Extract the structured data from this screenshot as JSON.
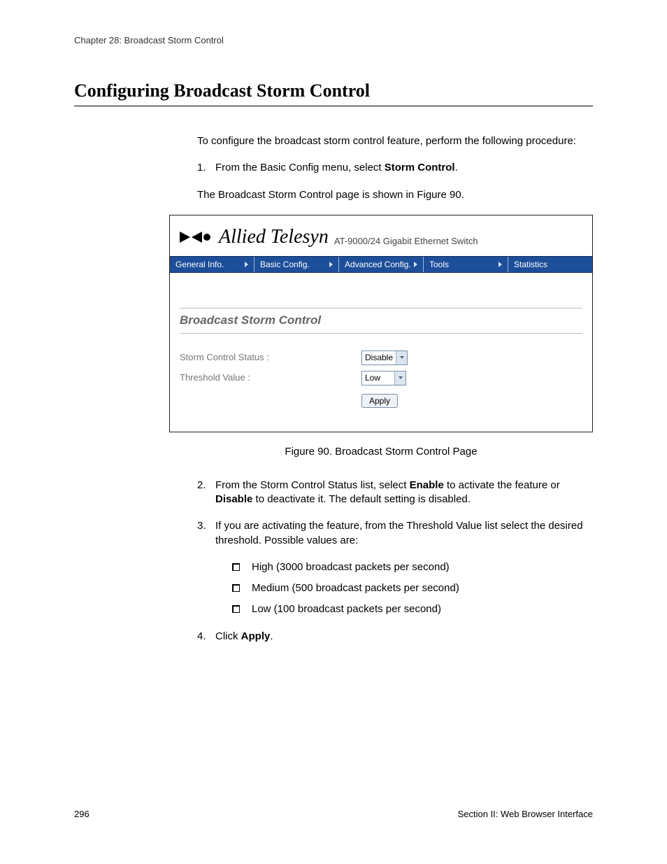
{
  "chapter_header": "Chapter 28: Broadcast Storm Control",
  "section_title": "Configuring Broadcast Storm Control",
  "intro": "To configure the broadcast storm control feature, perform the following procedure:",
  "step1_pre": "From the Basic Config menu, select ",
  "step1_bold": "Storm Control",
  "step1_post": ".",
  "step1_result": "The Broadcast Storm Control page is shown in Figure 90.",
  "brand_name": "Allied Telesyn",
  "brand_sub": "AT-9000/24 Gigabit Ethernet Switch",
  "nav": {
    "t1": "General Info.",
    "t2": "Basic Config.",
    "t3": "Advanced Config.",
    "t4": "Tools",
    "t5": "Statistics"
  },
  "fig_heading": "Broadcast Storm Control",
  "fld_status_label": "Storm Control Status :",
  "fld_status_value": "Disable",
  "fld_thresh_label": "Threshold Value :",
  "fld_thresh_value": "Low",
  "apply_label": "Apply",
  "figure_caption": "Figure 90. Broadcast Storm Control Page",
  "step2_a": "From the Storm Control Status list, select ",
  "step2_b": "Enable",
  "step2_c": " to activate the feature or ",
  "step2_d": "Disable",
  "step2_e": " to deactivate it. The default setting is disabled.",
  "step3": "If you are activating the feature, from the Threshold Value list select the desired threshold. Possible values are:",
  "opt_high": "High (3000 broadcast packets per second)",
  "opt_med": "Medium (500 broadcast packets per second)",
  "opt_low": "Low (100 broadcast packets per second)",
  "step4_a": "Click ",
  "step4_b": "Apply",
  "step4_c": ".",
  "page_number": "296",
  "footer_section": "Section II: Web Browser Interface"
}
